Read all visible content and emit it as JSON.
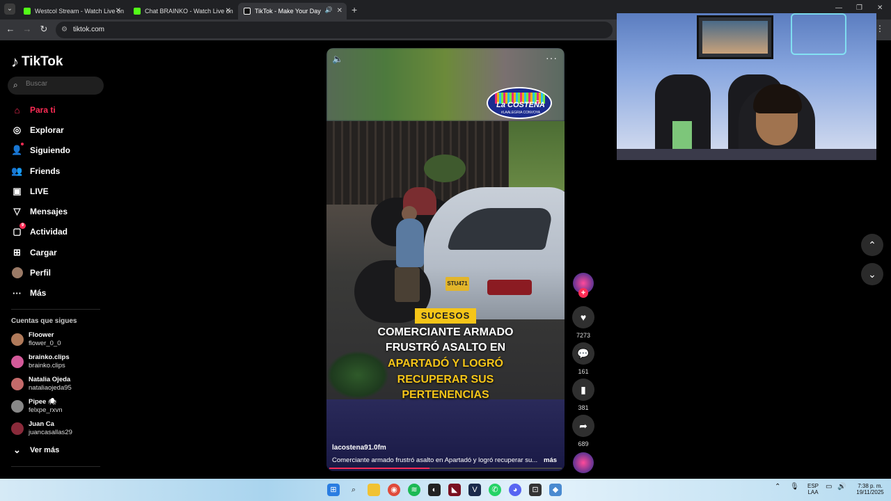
{
  "browser": {
    "tabs": [
      {
        "title": "Westcol Stream - Watch Live on",
        "fav_color": "#53fc18"
      },
      {
        "title": "Chat BRAINKO - Watch Live on",
        "fav_color": "#53fc18"
      },
      {
        "title": "TikTok - Make Your Day",
        "fav_color": "#111111"
      }
    ],
    "url": "tiktok.com",
    "new_tab": "+"
  },
  "sidebar": {
    "brand": "TikTok",
    "search_placeholder": "Buscar",
    "nav": [
      {
        "label": "Para ti",
        "icon": "home-icon"
      },
      {
        "label": "Explorar",
        "icon": "compass-icon"
      },
      {
        "label": "Siguiendo",
        "icon": "following-icon"
      },
      {
        "label": "Friends",
        "icon": "friends-icon"
      },
      {
        "label": "LIVE",
        "icon": "live-icon"
      },
      {
        "label": "Mensajes",
        "icon": "send-icon"
      },
      {
        "label": "Actividad",
        "icon": "activity-icon",
        "badge": "9"
      },
      {
        "label": "Cargar",
        "icon": "upload-icon"
      },
      {
        "label": "Perfil",
        "icon": "profile-avatar"
      },
      {
        "label": "Más",
        "icon": "more-icon"
      }
    ],
    "following_title": "Cuentas que sigues",
    "following": [
      {
        "name": "Floower",
        "handle": "flower_0_0",
        "color": "#b07a5a"
      },
      {
        "name": "brainko.clips",
        "handle": "brainko.clips",
        "color": "#d45a9a"
      },
      {
        "name": "Natalia Ojeda",
        "handle": "nataliaojeda95",
        "color": "#c46a6a"
      },
      {
        "name": "Pipee 🕷",
        "handle": "felxpe_rxvn",
        "color": "#888888"
      },
      {
        "name": "Juan Ca",
        "handle": "juancasallas29",
        "color": "#8a2a3a"
      }
    ],
    "see_more": "Ver más"
  },
  "video": {
    "station_logo": "La COSTEÑA",
    "station_sub": "#LAALEGRIA CONVOYA",
    "plate": "STU471",
    "tag": "SUCESOS",
    "headline_lines": [
      {
        "text": "COMERCIANTE ARMADO",
        "color": "white"
      },
      {
        "text": "FRUSTRÓ ASALTO EN",
        "color": "white"
      },
      {
        "text": "APARTADÓ Y LOGRÓ",
        "color": "yellow"
      },
      {
        "text": "RECUPERAR SUS",
        "color": "yellow"
      },
      {
        "text": "PERTENENCIAS",
        "color": "yellow"
      }
    ],
    "author": "lacostena91.0fm",
    "description": "Comerciante armado frustró asalto en Apartadó y logró recuperar su...",
    "more": "más",
    "progress": 0.43
  },
  "actions": {
    "likes": "7273",
    "comments": "161",
    "saves": "381",
    "shares": "689"
  },
  "taskbar": {
    "lang": "ESP",
    "lang2": "LAA",
    "time": "7:38 p. m.",
    "date": "19/11/2025"
  }
}
